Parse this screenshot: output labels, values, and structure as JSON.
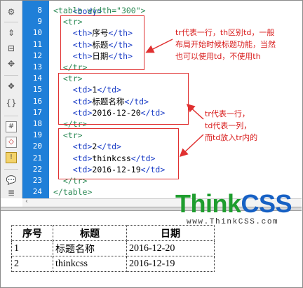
{
  "editor": {
    "partial_top_line": "<body>",
    "line_numbers": [
      "8",
      "9",
      "10",
      "11",
      "12",
      "13",
      "14",
      "15",
      "16",
      "17",
      "18",
      "19",
      "20",
      "21",
      "22",
      "23",
      "24"
    ],
    "lines": [
      {
        "indent": "",
        "pre": "<table width=",
        "val": "\"300\"",
        "post": ">"
      },
      {
        "indent": "  ",
        "pre": "<tr>",
        "val": "",
        "post": ""
      },
      {
        "indent": "    ",
        "pre": "<th>",
        "text": "序号",
        "post": "</th>"
      },
      {
        "indent": "    ",
        "pre": "<th>",
        "text": "标题",
        "post": "</th>"
      },
      {
        "indent": "    ",
        "pre": "<th>",
        "text": "日期",
        "post": "</th>"
      },
      {
        "indent": "  ",
        "pre": "</tr>",
        "val": "",
        "post": ""
      },
      {
        "indent": "  ",
        "pre": "<tr>",
        "val": "",
        "post": ""
      },
      {
        "indent": "    ",
        "pre": "<td>",
        "text": "1",
        "post": "</td>"
      },
      {
        "indent": "    ",
        "pre": "<td>",
        "text": "标题名称",
        "post": "</td>"
      },
      {
        "indent": "    ",
        "pre": "<td>",
        "text": "2016-12-20",
        "post": "</td>"
      },
      {
        "indent": "  ",
        "pre": "</tr>",
        "val": "",
        "post": ""
      },
      {
        "indent": "  ",
        "pre": "<tr>",
        "val": "",
        "post": ""
      },
      {
        "indent": "    ",
        "pre": "<td>",
        "text": "2",
        "post": "</td>"
      },
      {
        "indent": "    ",
        "pre": "<td>",
        "text": "thinkcss",
        "post": "</td>"
      },
      {
        "indent": "    ",
        "pre": "<td>",
        "text": "2016-12-19",
        "post": "</td>"
      },
      {
        "indent": "  ",
        "pre": "</tr>",
        "val": "",
        "post": ""
      },
      {
        "indent": "",
        "pre": "</table>",
        "val": "",
        "post": ""
      }
    ],
    "toolbar_icons": [
      "gear-icon",
      "expand-tag-icon",
      "collapse-selection-icon",
      "expand-all-icon",
      "select-parent-tag-icon",
      "balance-braces-icon",
      "line-numbers-icon",
      "highlight-invalid-code-icon",
      "syntax-coloring-icon",
      "apply-comment-icon"
    ]
  },
  "annotations": {
    "note1_lines": [
      "tr代表一行，th区别td，一般",
      "布局开始时候标题功能，当然",
      "也可以使用td，不使用th"
    ],
    "note2_lines": [
      "tr代表一行，",
      "td代表一列，",
      "而td放入tr内的"
    ],
    "color": "#e03030"
  },
  "brand": {
    "think": "Think",
    "css": "CSS",
    "url": "www.ThinkCSS.com"
  },
  "preview": {
    "headers": [
      "序号",
      "标题",
      "日期"
    ],
    "rows": [
      [
        "1",
        "标题名称",
        "2016-12-20"
      ],
      [
        "2",
        "thinkcss",
        "2016-12-19"
      ]
    ]
  },
  "colors": {
    "gutter": "#1f7fd8",
    "tag": "#1b3dc6",
    "value": "#2e8b57",
    "brand_green": "#1e9d2e",
    "brand_blue": "#1660c4"
  }
}
